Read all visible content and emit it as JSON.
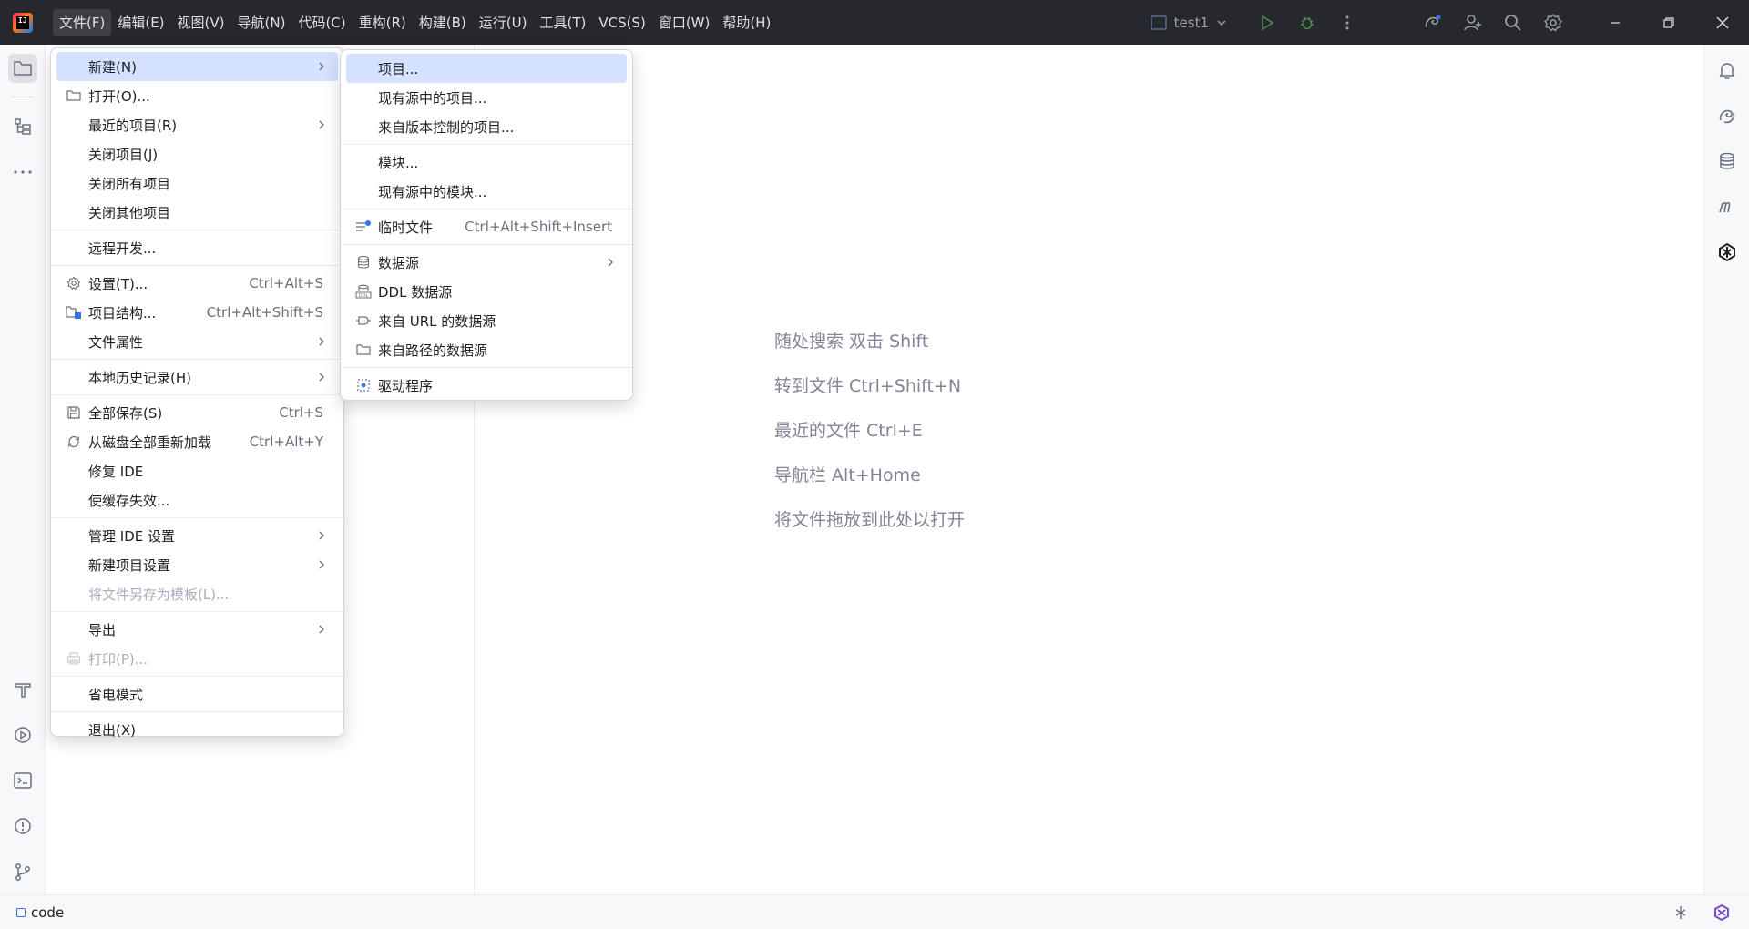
{
  "menubar": {
    "items": [
      "文件(F)",
      "编辑(E)",
      "视图(V)",
      "导航(N)",
      "代码(C)",
      "重构(R)",
      "构建(B)",
      "运行(U)",
      "工具(T)",
      "VCS(S)",
      "窗口(W)",
      "帮助(H)"
    ]
  },
  "run_config": {
    "name": "test1"
  },
  "file_menu": {
    "new": "新建(N)",
    "open": "打开(O)...",
    "recent_projects": "最近的项目(R)",
    "close_project": "关闭项目(J)",
    "close_all_projects": "关闭所有项目",
    "close_other_projects": "关闭其他项目",
    "remote_dev": "远程开发...",
    "settings": "设置(T)...",
    "settings_shortcut": "Ctrl+Alt+S",
    "project_structure": "项目结构...",
    "project_structure_shortcut": "Ctrl+Alt+Shift+S",
    "file_properties": "文件属性",
    "local_history": "本地历史记录(H)",
    "save_all": "全部保存(S)",
    "save_all_shortcut": "Ctrl+S",
    "reload_all": "从磁盘全部重新加载",
    "reload_all_shortcut": "Ctrl+Alt+Y",
    "repair_ide": "修复 IDE",
    "invalidate_caches": "使缓存失效...",
    "manage_ide_settings": "管理 IDE 设置",
    "new_project_settings": "新建项目设置",
    "save_as_template": "将文件另存为模板(L)...",
    "export": "导出",
    "print": "打印(P)...",
    "power_save": "省电模式",
    "exit": "退出(X)"
  },
  "new_submenu": {
    "project": "项目...",
    "project_from_sources": "现有源中的项目...",
    "project_from_vcs": "来自版本控制的项目...",
    "module": "模块...",
    "module_from_sources": "现有源中的模块...",
    "scratch_file": "临时文件",
    "scratch_file_shortcut": "Ctrl+Alt+Shift+Insert",
    "data_source": "数据源",
    "ddl_data_source": "DDL 数据源",
    "url_data_source": "来自 URL 的数据源",
    "path_data_source": "来自路径的数据源",
    "driver": "驱动程序"
  },
  "editor_hints": [
    "随处搜索 双击 Shift",
    "转到文件 Ctrl+Shift+N",
    "最近的文件 Ctrl+E",
    "导航栏 Alt+Home",
    "将文件拖放到此处以打开"
  ],
  "statusbar": {
    "project": "code"
  },
  "colors": {
    "accent": "#3574f0",
    "selection": "#d4e2ff",
    "titlebar": "#27282e"
  }
}
